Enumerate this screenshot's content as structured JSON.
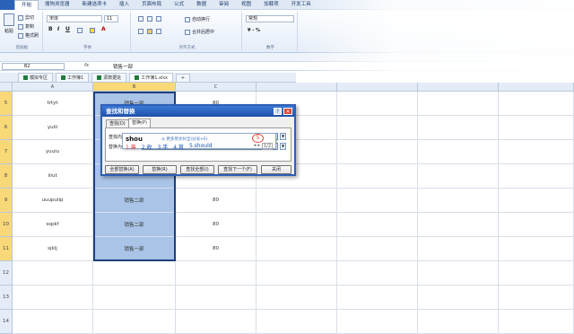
{
  "menubar": {
    "tabs": [
      "开始",
      "插入",
      "页面布局",
      "公式",
      "数据",
      "审阅",
      "视图",
      "加载项",
      "开发工具"
    ],
    "blurred_tabs": [
      "搜狗浏览器",
      "新建选项卡"
    ]
  },
  "ribbon": {
    "clipboard": {
      "paste": "粘贴",
      "cut": "剪切",
      "copy": "复制",
      "format_painter": "格式刷",
      "label": "剪贴板"
    },
    "font": {
      "name": "宋体",
      "size": "11",
      "label": "字体"
    },
    "alignment": {
      "wrap": "自动换行",
      "merge": "合并后居中",
      "label": "对齐方式"
    },
    "number": {
      "format": "常规",
      "label": "数字"
    }
  },
  "formula_bar": {
    "name_box": "B2",
    "fx": "fx",
    "value": "销售一部"
  },
  "sheet_tabs": [
    {
      "label": "模拟专区",
      "active": false
    },
    {
      "label": "工作簿1",
      "active": false
    },
    {
      "label": "源数据处",
      "active": false
    },
    {
      "label": "工作簿1.xlsx",
      "active": true
    }
  ],
  "columns": [
    "A",
    "B",
    "C"
  ],
  "rows": [
    {
      "num": "5",
      "a": "trtyt",
      "b": "销售一部",
      "c": "80"
    },
    {
      "num": "6",
      "a": "yuiii",
      "b": "",
      "c": ""
    },
    {
      "num": "7",
      "a": "yuuiu",
      "b": "",
      "c": ""
    },
    {
      "num": "8",
      "a": "iiiut",
      "b": "",
      "c": ""
    },
    {
      "num": "9",
      "a": "uuupuiip",
      "b": "销售二部",
      "c": "80"
    },
    {
      "num": "10",
      "a": "sspkf",
      "b": "销售二部",
      "c": "80"
    },
    {
      "num": "11",
      "a": "sjklj",
      "b": "销售一部",
      "c": "80"
    },
    {
      "num": "12",
      "a": "",
      "b": "",
      "c": ""
    },
    {
      "num": "13",
      "a": "",
      "b": "",
      "c": ""
    },
    {
      "num": "14",
      "a": "",
      "b": "",
      "c": ""
    }
  ],
  "dialog": {
    "title": "查找和替换",
    "help": "?",
    "close": "✕",
    "tabs": [
      "查找(D)",
      "替换(P)"
    ],
    "find_label": "查找内容(N):",
    "replace_label": "替换为(E):",
    "buttons": [
      "全部替换(A)",
      "替换(R)",
      "查找全部(I)",
      "查找下一个(F)",
      "关闭"
    ]
  },
  "ime": {
    "typed": "shou",
    "hint": "◎ 更多英文补全(分号+E)",
    "candidates": [
      "1.兽",
      "2.收",
      "3.手",
      "4.首",
      "5.should"
    ],
    "circle_mark": "5",
    "page": "1/2"
  }
}
